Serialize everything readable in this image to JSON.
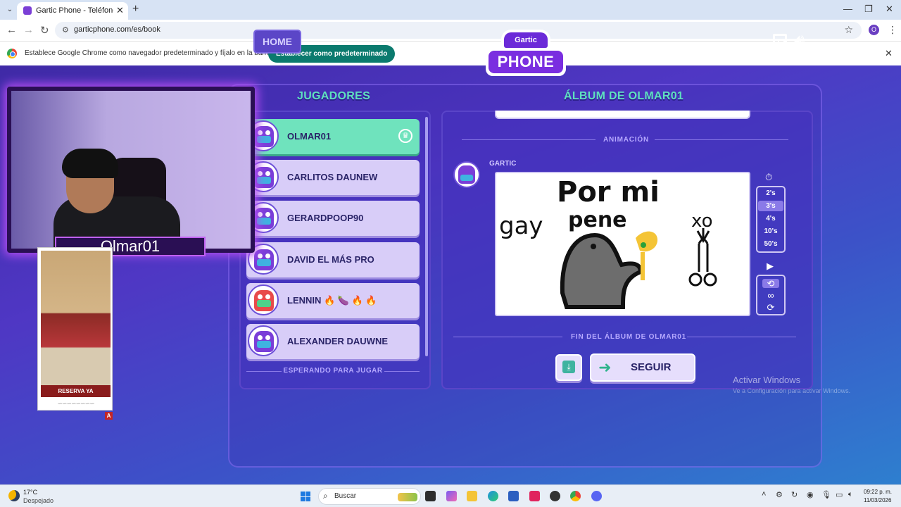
{
  "browser": {
    "tab_title": "Gartic Phone - Teléfono Descor",
    "url": "garticphone.com/es/book",
    "profile_initial": "O",
    "infobar_text": "Establece Google Chrome como navegador predeterminado y fíjalo en la barra de tareas",
    "infobar_button": "Establecer como predeterminado"
  },
  "game": {
    "home_label": "HOME",
    "logo_top": "Gartic",
    "logo_main": "PHONE",
    "players_title": "JUGADORES",
    "album_title": "ÁLBUM DE OLMAR01",
    "players": [
      {
        "name": "OLMAR01",
        "active": true,
        "host": true
      },
      {
        "name": "CARLITOS DAUNEW"
      },
      {
        "name": "GERARDPOOP90"
      },
      {
        "name": "DAVID EL MÁS PRO"
      },
      {
        "name": "LENNIN 🔥 🍆 🔥 🔥"
      },
      {
        "name": "ALEXANDER DAUWNE"
      }
    ],
    "waiting_label": "ESPERANDO PARA JUGAR",
    "animation_label": "ANIMACIÓN",
    "author_name": "GARTIC",
    "drawing_texts": {
      "left": "gay",
      "top": "Por mi",
      "top2": "pene",
      "right": "xo"
    },
    "timer_options": [
      "2's",
      "3's",
      "4's",
      "10's",
      "50's"
    ],
    "timer_selected": "3's",
    "album_end_label": "FIN DEL ÁLBUM DE OLMAR01",
    "seguir_label": "SEGUIR"
  },
  "overlay": {
    "streamer_name": "Olmar01",
    "ad_cta": "RESERVA YA",
    "ad_badge": "A"
  },
  "windows": {
    "activate_title": "Activar Windows",
    "activate_sub": "Ve a Configuración para activar Windows.",
    "weather_temp": "17°C",
    "weather_desc": "Despejado",
    "search_placeholder": "Buscar",
    "time": "09:22 p. m.",
    "date": "11/03/2026"
  },
  "colors": {
    "accent_teal": "#5fe0c0",
    "active_player": "#6fe3bd",
    "infobar_button_bg": "#0b7a6e"
  }
}
